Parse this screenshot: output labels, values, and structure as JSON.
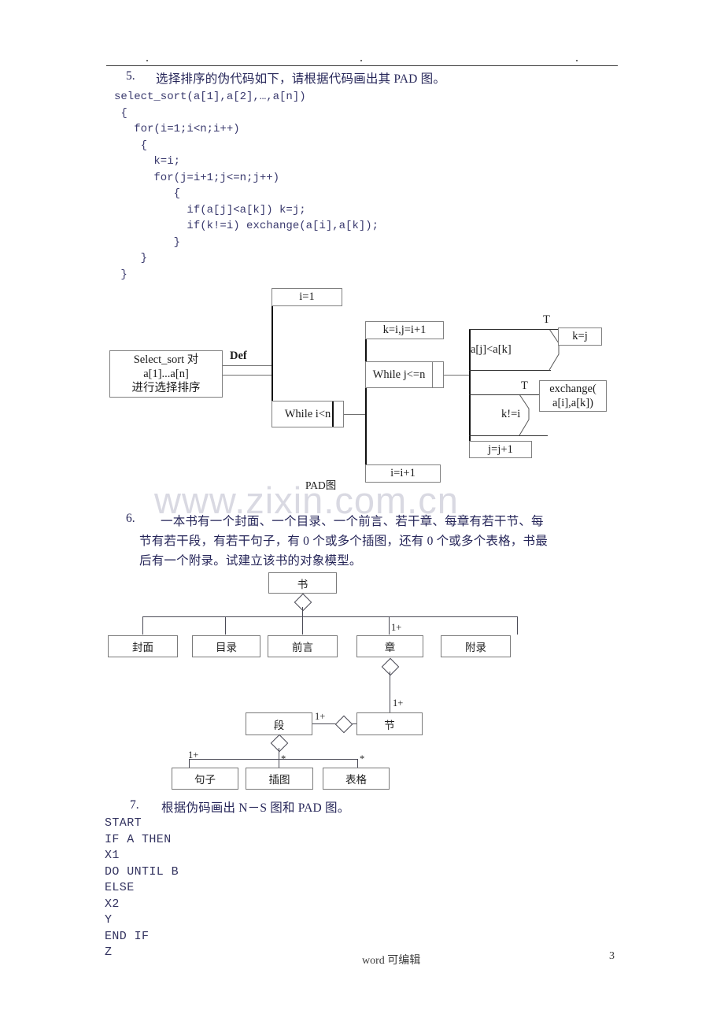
{
  "page": {
    "footer_note": "word 可编辑",
    "page_number": "3",
    "watermark": "www.zixin.com.cn"
  },
  "q5": {
    "number": "5.",
    "prompt": "选择排序的伪代码如下，请根据代码画出其 PAD 图。",
    "code": "select_sort(a[1],a[2],…,a[n])\n {\n   for(i=1;i<n;i++)\n    {\n      k=i;\n      for(j=i+1;j<=n;j++)\n         {\n           if(a[j]<a[k]) k=j;\n           if(k!=i) exchange(a[i],a[k]);\n         }\n    }\n }",
    "pad": {
      "caption": "PAD图",
      "root_line1": "Select_sort 对",
      "root_line2": "a[1]...a[n]",
      "root_line3": "进行选择排序",
      "def_label": "Def",
      "init_i": "i=1",
      "while_i": "While  i<n",
      "i_incr": "i=i+1",
      "init_kj": "k=i,j=i+1",
      "while_j": "While j<=n",
      "j_incr": "j=j+1",
      "cond1": "a[j]<a[k]",
      "cond1_true_label": "T",
      "cond1_action": "k=j",
      "cond2": "k!=i",
      "cond2_true_label": "T",
      "cond2_action_line1": "exchange(",
      "cond2_action_line2": "a[i],a[k])"
    }
  },
  "q6": {
    "number": "6.",
    "prompt_line1": "一本书有一个封面、一个目录、一个前言、若干章、每章有若干节、每",
    "prompt_line2": "节有若干段，有若干句子，有 0 个或多个插图，还有 0 个或多个表格，书最",
    "prompt_line3": "后有一个附录。试建立该书的对象模型。",
    "model": {
      "root": "书",
      "children": [
        {
          "label": "封面",
          "mult": ""
        },
        {
          "label": "目录",
          "mult": ""
        },
        {
          "label": "前言",
          "mult": ""
        },
        {
          "label": "章",
          "mult": "1+"
        },
        {
          "label": "附录",
          "mult": ""
        }
      ],
      "section": {
        "label": "节",
        "mult": "1+"
      },
      "paragraph": {
        "label": "段",
        "mult": "1+"
      },
      "leaves": [
        {
          "label": "句子",
          "mult": "1+"
        },
        {
          "label": "插图",
          "mult": "*"
        },
        {
          "label": "表格",
          "mult": "*"
        }
      ]
    }
  },
  "q7": {
    "number": "7.",
    "prompt": "根据伪码画出 N－S 图和 PAD 图。",
    "code": "START\nIF A THEN\nX1\nDO UNTIL B\nELSE\nX2\nY\nEND IF\nZ"
  }
}
